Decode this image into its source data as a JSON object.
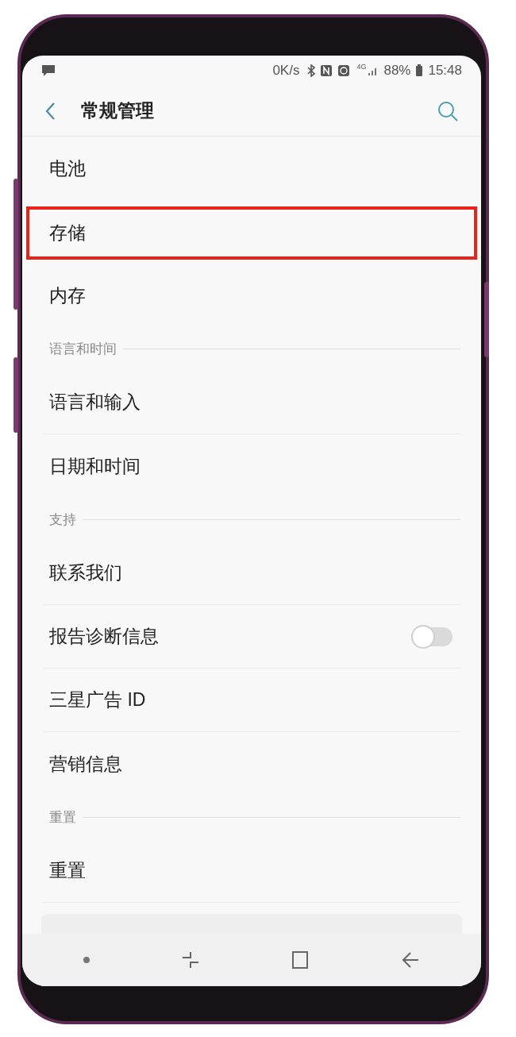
{
  "status_bar": {
    "speed": "0K/s",
    "network": "4G",
    "battery": "88%",
    "time": "15:48"
  },
  "header": {
    "title": "常规管理"
  },
  "sections": [
    {
      "items": [
        {
          "label": "电池",
          "kind": "plain",
          "highlighted": false
        },
        {
          "label": "存储",
          "kind": "plain",
          "highlighted": true
        },
        {
          "label": "内存",
          "kind": "plain",
          "highlighted": false
        }
      ]
    },
    {
      "header": "语言和时间",
      "items": [
        {
          "label": "语言和输入",
          "kind": "plain",
          "highlighted": false
        },
        {
          "label": "日期和时间",
          "kind": "plain",
          "highlighted": false
        }
      ]
    },
    {
      "header": "支持",
      "items": [
        {
          "label": "联系我们",
          "kind": "plain",
          "highlighted": false
        },
        {
          "label": "报告诊断信息",
          "kind": "toggle",
          "on": false,
          "highlighted": false
        },
        {
          "label": "三星广告 ID",
          "kind": "plain",
          "highlighted": false
        },
        {
          "label": "营销信息",
          "kind": "plain",
          "highlighted": false
        }
      ]
    },
    {
      "header": "重置",
      "items": [
        {
          "label": "重置",
          "kind": "plain",
          "highlighted": false
        }
      ]
    }
  ]
}
